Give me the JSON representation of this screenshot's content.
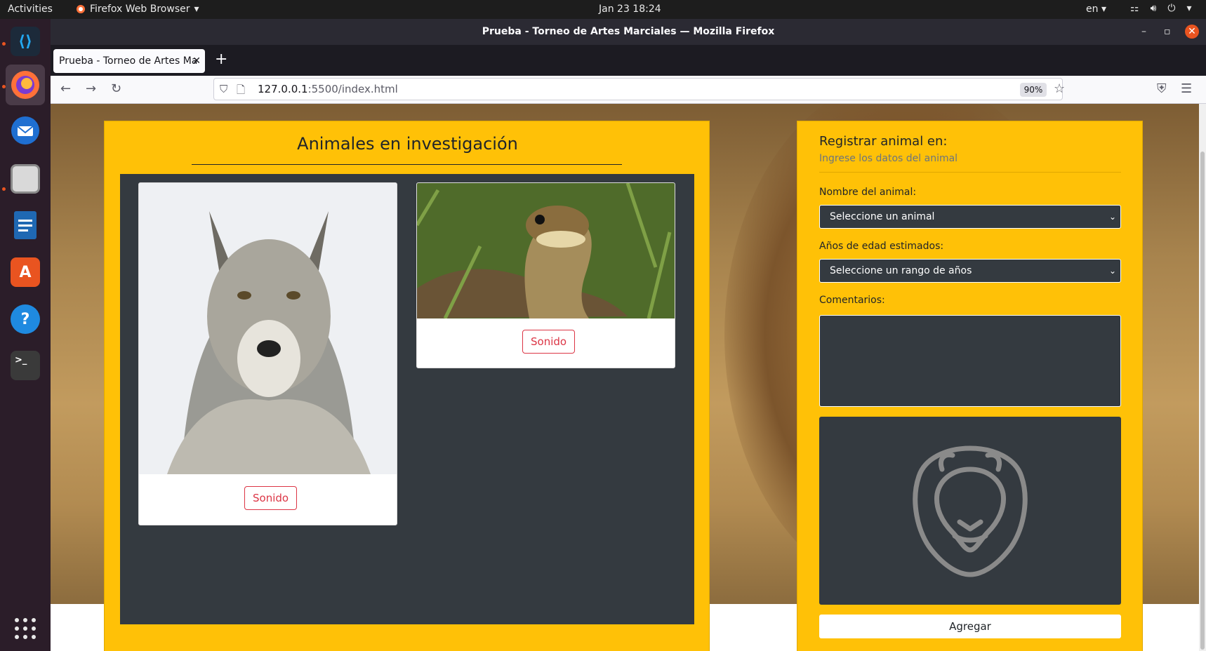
{
  "topbar": {
    "activities": "Activities",
    "app_name": "Firefox Web Browser",
    "clock": "Jan 23  18:24",
    "lang": "en"
  },
  "dock": {
    "apps": [
      "vscode-icon",
      "firefox-icon",
      "thunderbird-icon",
      "files-icon",
      "writer-icon",
      "software-icon",
      "help-icon",
      "terminal-icon",
      "app-grid-icon"
    ]
  },
  "window": {
    "title": "Prueba - Torneo de Artes Marciales — Mozilla Firefox",
    "tab_title": "Prueba - Torneo de Artes Ma",
    "url_host": "127.0.0.1",
    "url_rest": ":5500/index.html",
    "zoom": "90%"
  },
  "page": {
    "left_title": "Animales en investigación",
    "cards": [
      {
        "animal": "wolf",
        "sound_label": "Sonido"
      },
      {
        "animal": "snake",
        "sound_label": "Sonido"
      }
    ],
    "form": {
      "title": "Registrar animal en:",
      "subtitle": "Ingrese los datos del animal",
      "name_label": "Nombre del animal:",
      "name_select": "Seleccione un animal",
      "age_label": "Años de edad estimados:",
      "age_select": "Seleccione un rango de años",
      "comments_label": "Comentarios:",
      "comments_value": "",
      "preview_icon": "lion-icon",
      "add_label": "Agregar"
    }
  },
  "colors": {
    "panel_yellow": "#ffc107",
    "dark": "#343a40",
    "danger": "#dc3545"
  }
}
